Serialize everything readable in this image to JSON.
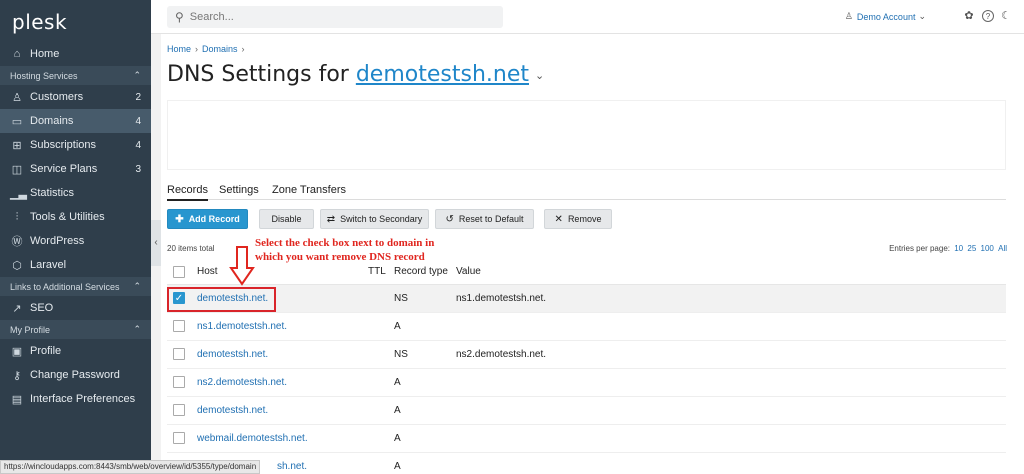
{
  "sidebar": {
    "logo": "plesk",
    "home": {
      "label": "Home"
    },
    "hosting_section": "Hosting Services",
    "hosting_items": [
      {
        "label": "Customers",
        "count": "2",
        "icon": "user-icon"
      },
      {
        "label": "Domains",
        "count": "4",
        "icon": "monitor-icon"
      },
      {
        "label": "Subscriptions",
        "count": "4",
        "icon": "grid-icon"
      },
      {
        "label": "Service Plans",
        "count": "3",
        "icon": "columns-icon"
      },
      {
        "label": "Statistics",
        "count": "",
        "icon": "bar-chart-icon"
      },
      {
        "label": "Tools & Utilities",
        "count": "",
        "icon": "sliders-icon"
      },
      {
        "label": "WordPress",
        "count": "",
        "icon": "wordpress-icon"
      },
      {
        "label": "Laravel",
        "count": "",
        "icon": "laravel-icon"
      }
    ],
    "links_section": "Links to Additional Services",
    "seo": {
      "label": "SEO"
    },
    "profile_section": "My Profile",
    "profile_items": [
      {
        "label": "Profile"
      },
      {
        "label": "Change Password"
      },
      {
        "label": "Interface Preferences"
      }
    ]
  },
  "topbar": {
    "search_placeholder": "Search...",
    "account_label": "Demo Account"
  },
  "breadcrumb": {
    "home": "Home",
    "domains": "Domains"
  },
  "title": {
    "prefix": "DNS Settings for",
    "domain": "demotestsh.net"
  },
  "tabs": [
    {
      "label": "Records",
      "active": true
    },
    {
      "label": "Settings",
      "active": false
    },
    {
      "label": "Zone Transfers",
      "active": false
    }
  ],
  "toolbar": {
    "add": "Add Record",
    "disable": "Disable",
    "switch": "Switch to Secondary",
    "reset": "Reset to Default",
    "remove": "Remove"
  },
  "list": {
    "total": "20 items total",
    "per_page_label": "Entries per page:",
    "per_page_options": [
      "10",
      "25",
      "100",
      "All"
    ]
  },
  "annotation": {
    "line1": "Select the check box next to domain in",
    "line2": "which you want remove DNS record"
  },
  "table": {
    "headers": {
      "host": "Host",
      "ttl": "TTL",
      "type": "Record type",
      "value": "Value"
    },
    "rows": [
      {
        "host": "demotestsh.net.",
        "type": "NS",
        "value": "ns1.demotestsh.net.",
        "checked": true
      },
      {
        "host": "ns1.demotestsh.net.",
        "type": "A",
        "value": "",
        "checked": false
      },
      {
        "host": "demotestsh.net.",
        "type": "NS",
        "value": "ns2.demotestsh.net.",
        "checked": false
      },
      {
        "host": "ns2.demotestsh.net.",
        "type": "A",
        "value": "",
        "checked": false
      },
      {
        "host": "demotestsh.net.",
        "type": "A",
        "value": "",
        "checked": false
      },
      {
        "host": "webmail.demotestsh.net.",
        "type": "A",
        "value": "",
        "checked": false
      },
      {
        "host": "sh.net.",
        "type": "A",
        "value": "",
        "checked": false
      }
    ]
  },
  "statusbar": {
    "url": "https://wincloudapps.com:8443/smb/web/overview/id/5355/type/domain"
  },
  "colors": {
    "sidebar_bg": "#2f3e4b",
    "accent": "#2896cf",
    "link": "#1f6fb2",
    "annotation": "#e0261f"
  }
}
